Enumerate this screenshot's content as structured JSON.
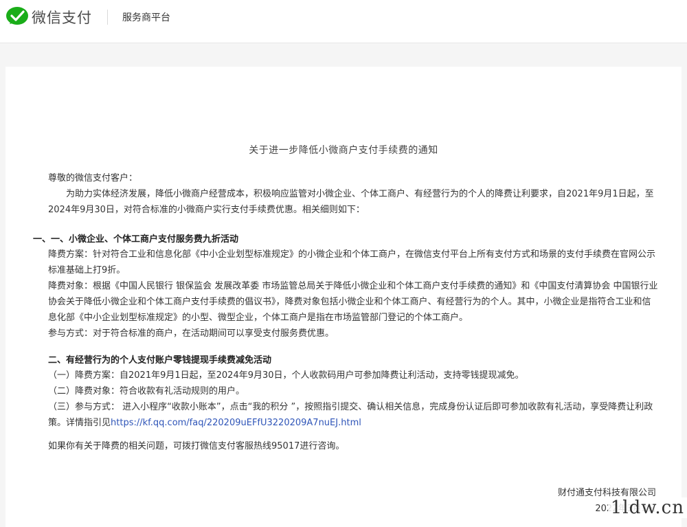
{
  "header": {
    "brand": "微信支付",
    "subtitle": "服务商平台"
  },
  "notice": {
    "title": "关于进一步降低小微商户支付手续费的通知",
    "greeting": "尊敬的微信支付客户：",
    "intro": "为助力实体经济发展，降低小微商户经营成本，积极响应监管对小微企业、个体工商户、有经营行为的个人的降费让利要求，自2021年9月1日起，至2024年9月30日，对符合标准的小微商户实行支付手续费优惠。相关细则如下：",
    "section1": {
      "heading": "一、一、小微企业、个体工商户支付服务费九折活动",
      "plan": "降费方案：针对符合工业和信息化部《中小企业划型标准规定》的小微企业和个体工商户，在微信支付平台上所有支付方式和场景的支付手续费在官网公示标准基础上打9折。",
      "target": "降费对象：根据《中国人民银行 银保监会 发展改革委 市场监管总局关于降低小微企业和个体工商户支付手续费的通知》和《中国支付清算协会 中国银行业协会关于降低小微企业和个体工商户支付手续费的倡议书》，降费对象包括小微企业和个体工商户、有经营行为的个人。其中，小微企业是指符合工业和信息化部《中小企业划型标准规定》的小型、微型企业，个体工商户是指在市场监管部门登记的个体工商户。",
      "method": "参与方式：对于符合标准的商户，在活动期间可以享受支付服务费优惠。"
    },
    "section2": {
      "heading": "二、有经营行为的个人支付账户零钱提现手续费减免活动",
      "item1": "（一）降费方案：自2021年9月1日起，至2024年9月30日，个人收款码用户可参加降费让利活动，支持零钱提现减免。",
      "item2": "（二）降费对象：符合收款有礼活动规则的用户。",
      "item3": "（三）参与方式： 进入小程序“收款小账本”，点击“我的积分 ”，按照指引提交、确认相关信息，完成身份认证后即可参加收款有礼活动，享受降费让利政策。详情指引见",
      "link": "https://kf.qq.com/faq/220209uEFfU3220209A7nuEJ.html"
    },
    "contact": "如果你有关于降费的相关问题，可拨打微信支付客服热线95017进行咨询。",
    "company": "财付通支付科技有限公司",
    "date": "2022年3月3日"
  },
  "watermark": "1ldw.cn",
  "colors": {
    "wechat_green": "#1aad19",
    "link_blue": "#2f55b8"
  },
  "icons": {
    "logo": "wechat-pay-logo"
  }
}
